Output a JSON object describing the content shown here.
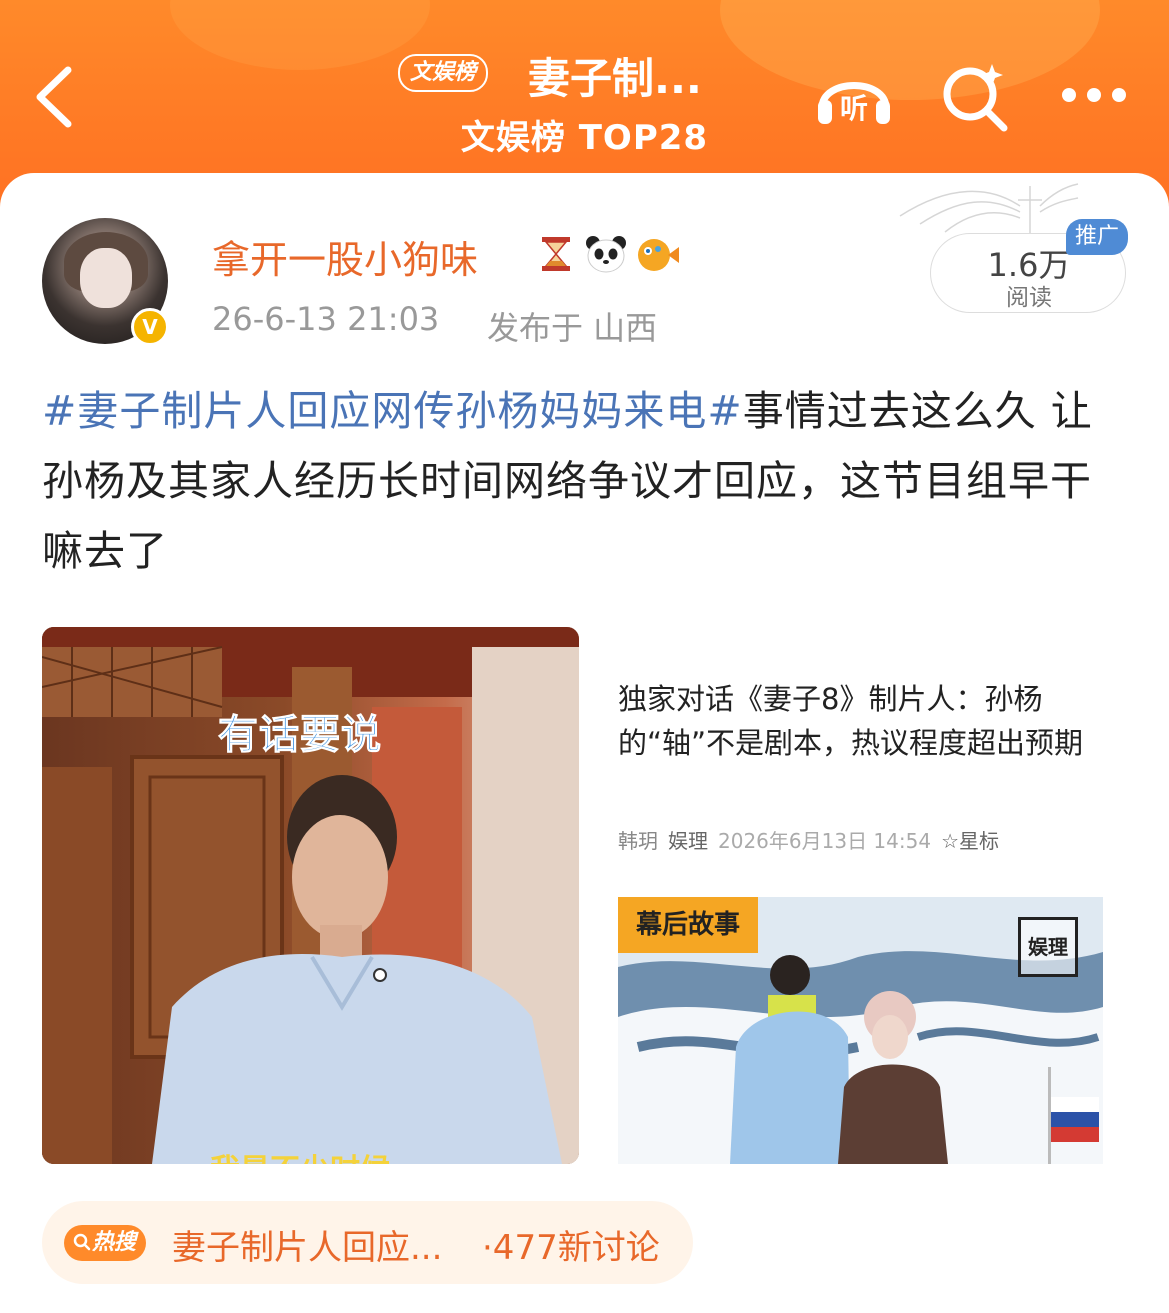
{
  "header": {
    "board_badge": "文娱榜",
    "title": "妻子制...",
    "subtitle": "文娱榜 TOP28",
    "listen_label": "听"
  },
  "post": {
    "username": "拿开一股小狗味",
    "emoji_icons": [
      "hourglass-icon",
      "panda-icon",
      "pufferfish-icon"
    ],
    "verified_badge": "V",
    "time": "26-6-13 21:03",
    "location": "发布于 山西",
    "read_count": "1.6万",
    "read_label": "阅读",
    "promo_tag": "推广",
    "hashtag": "#妻子制片人回应网传孙杨妈妈来电#",
    "body": "事情过去这么久 让孙杨及其家人经历长时间网络争议才回应，这节目组早干嘛去了"
  },
  "images": {
    "left_caption": "有话要说",
    "left_bottom_text": "我是不少时候",
    "article_title": "独家对话《妻子8》制片人：孙杨的“轴”不是剧本，热议程度超出预期",
    "article_author": "韩玥",
    "article_source": "娱理",
    "article_date": "2026年6月13日 14:54",
    "article_star": "☆星标",
    "photo_tag": "幕后故事",
    "photo_logo": "娱理"
  },
  "hot_search": {
    "badge": "热搜",
    "topic": "妻子制片人回应...",
    "count": "·477新讨论"
  },
  "colors": {
    "header_orange": "#ff7a25",
    "username": "#e8682a",
    "hashtag": "#4a74b6",
    "promo": "#4f8bd5"
  }
}
